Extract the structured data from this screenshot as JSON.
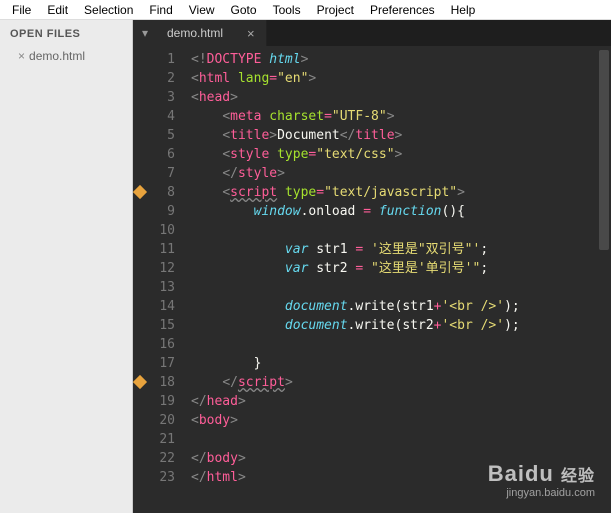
{
  "menu": [
    "File",
    "Edit",
    "Selection",
    "Find",
    "View",
    "Goto",
    "Tools",
    "Project",
    "Preferences",
    "Help"
  ],
  "sidebar": {
    "header": "OPEN FILES",
    "files": [
      {
        "name": "demo.html"
      }
    ]
  },
  "tabs": [
    {
      "label": "demo.html",
      "active": true
    }
  ],
  "lines": 23,
  "bookmarks": [
    8,
    18
  ],
  "code": [
    [
      [
        "c-gray",
        "<!"
      ],
      [
        "c-pink",
        "DOCTYPE"
      ],
      [
        "c-white",
        " "
      ],
      [
        "c-cyan",
        "html"
      ],
      [
        "c-gray",
        ">"
      ]
    ],
    [
      [
        "c-gray",
        "<"
      ],
      [
        "c-pink",
        "html"
      ],
      [
        "c-white",
        " "
      ],
      [
        "c-green",
        "lang"
      ],
      [
        "c-pink",
        "="
      ],
      [
        "c-yellow",
        "\"en\""
      ],
      [
        "c-gray",
        ">"
      ]
    ],
    [
      [
        "c-gray",
        "<"
      ],
      [
        "c-pink",
        "head"
      ],
      [
        "c-gray",
        ">"
      ]
    ],
    [
      [
        "c-white",
        "    "
      ],
      [
        "c-gray",
        "<"
      ],
      [
        "c-pink",
        "meta"
      ],
      [
        "c-white",
        " "
      ],
      [
        "c-green",
        "charset"
      ],
      [
        "c-pink",
        "="
      ],
      [
        "c-yellow",
        "\"UTF-8\""
      ],
      [
        "c-gray",
        ">"
      ]
    ],
    [
      [
        "c-white",
        "    "
      ],
      [
        "c-gray",
        "<"
      ],
      [
        "c-pink",
        "title"
      ],
      [
        "c-gray",
        ">"
      ],
      [
        "c-white",
        "Document"
      ],
      [
        "c-gray",
        "</"
      ],
      [
        "c-pink",
        "title"
      ],
      [
        "c-gray",
        ">"
      ]
    ],
    [
      [
        "c-white",
        "    "
      ],
      [
        "c-gray",
        "<"
      ],
      [
        "c-pink",
        "style"
      ],
      [
        "c-white",
        " "
      ],
      [
        "c-green",
        "type"
      ],
      [
        "c-pink",
        "="
      ],
      [
        "c-yellow",
        "\"text/css\""
      ],
      [
        "c-gray",
        ">"
      ]
    ],
    [
      [
        "c-white",
        "    "
      ],
      [
        "c-gray",
        "</"
      ],
      [
        "c-pink",
        "style"
      ],
      [
        "c-gray",
        ">"
      ]
    ],
    [
      [
        "c-white",
        "    "
      ],
      [
        "c-gray",
        "<"
      ],
      [
        "c-pink u",
        "script"
      ],
      [
        "c-white",
        " "
      ],
      [
        "c-green",
        "type"
      ],
      [
        "c-pink",
        "="
      ],
      [
        "c-yellow",
        "\"text/javascript\""
      ],
      [
        "c-gray",
        ">"
      ]
    ],
    [
      [
        "c-white",
        "        "
      ],
      [
        "c-cyan",
        "window"
      ],
      [
        "c-white",
        ".onload "
      ],
      [
        "c-pink",
        "="
      ],
      [
        "c-white",
        " "
      ],
      [
        "c-cyan",
        "function"
      ],
      [
        "c-white",
        "(){"
      ]
    ],
    [
      [
        "",
        ""
      ]
    ],
    [
      [
        "c-white",
        "            "
      ],
      [
        "c-cyan",
        "var"
      ],
      [
        "c-white",
        " str1 "
      ],
      [
        "c-pink",
        "="
      ],
      [
        "c-white",
        " "
      ],
      [
        "c-yellow",
        "'这里是\"双引号\"'"
      ],
      [
        "c-white",
        ";"
      ]
    ],
    [
      [
        "c-white",
        "            "
      ],
      [
        "c-cyan",
        "var"
      ],
      [
        "c-white",
        " str2 "
      ],
      [
        "c-pink",
        "="
      ],
      [
        "c-white",
        " "
      ],
      [
        "c-yellow",
        "\"这里是'单引号'\""
      ],
      [
        "c-white",
        ";"
      ]
    ],
    [
      [
        "",
        ""
      ]
    ],
    [
      [
        "c-white",
        "            "
      ],
      [
        "c-cyan",
        "document"
      ],
      [
        "c-white",
        ".write(str1"
      ],
      [
        "c-pink",
        "+"
      ],
      [
        "c-yellow",
        "'<br />'"
      ],
      [
        "c-white",
        ");"
      ]
    ],
    [
      [
        "c-white",
        "            "
      ],
      [
        "c-cyan",
        "document"
      ],
      [
        "c-white",
        ".write(str2"
      ],
      [
        "c-pink",
        "+"
      ],
      [
        "c-yellow",
        "'<br />'"
      ],
      [
        "c-white",
        ");"
      ]
    ],
    [
      [
        "",
        ""
      ]
    ],
    [
      [
        "c-white",
        "        }"
      ]
    ],
    [
      [
        "c-white",
        "    "
      ],
      [
        "c-gray",
        "</"
      ],
      [
        "c-pink u",
        "script"
      ],
      [
        "c-gray",
        ">"
      ]
    ],
    [
      [
        "c-gray",
        "</"
      ],
      [
        "c-pink",
        "head"
      ],
      [
        "c-gray",
        ">"
      ]
    ],
    [
      [
        "c-gray",
        "<"
      ],
      [
        "c-pink",
        "body"
      ],
      [
        "c-gray",
        ">"
      ]
    ],
    [
      [
        "",
        ""
      ]
    ],
    [
      [
        "c-gray",
        "</"
      ],
      [
        "c-pink",
        "body"
      ],
      [
        "c-gray",
        ">"
      ]
    ],
    [
      [
        "c-gray",
        "</"
      ],
      [
        "c-pink",
        "html"
      ],
      [
        "c-gray",
        ">"
      ]
    ]
  ],
  "watermark": {
    "brand": "Baidu",
    "cn": "经验",
    "url": "jingyan.baidu.com"
  }
}
